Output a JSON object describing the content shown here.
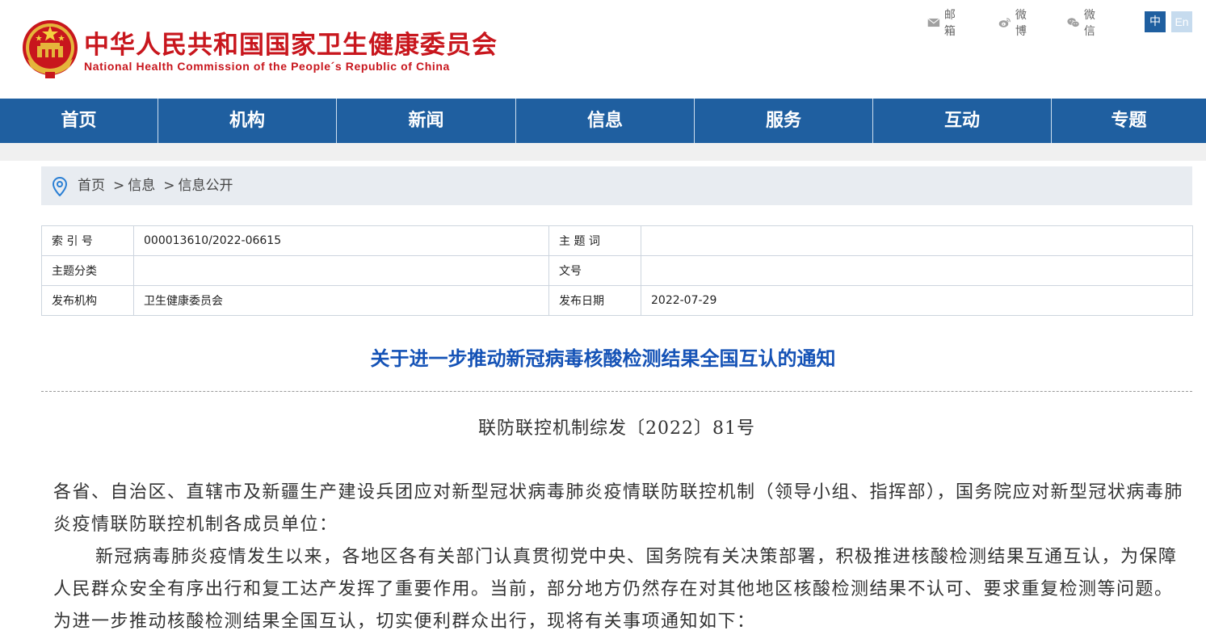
{
  "header": {
    "title_cn": "中华人民共和国国家卫生健康委员会",
    "title_en": "National Health Commission of the People´s Republic of China",
    "links": {
      "mail": {
        "label": "邮箱",
        "icon": "mail-icon"
      },
      "weibo": {
        "label": "微博",
        "icon": "weibo-icon"
      },
      "wechat": {
        "label": "微信",
        "icon": "wechat-icon"
      }
    },
    "lang": {
      "zh": "中",
      "en": "En"
    }
  },
  "nav": [
    "首页",
    "机构",
    "新闻",
    "信息",
    "服务",
    "互动",
    "专题"
  ],
  "breadcrumb": {
    "home": "首页",
    "level1": "信息",
    "level2": "信息公开",
    "sep": ">"
  },
  "meta": {
    "index_label": "索 引 号",
    "index_value": "000013610/2022-06615",
    "subject_word_label": "主 题 词",
    "subject_word_value": "",
    "category_label": "主题分类",
    "category_value": "",
    "docno_label": "文号",
    "docno_value": "",
    "publisher_label": "发布机构",
    "publisher_value": "卫生健康委员会",
    "date_label": "发布日期",
    "date_value": "2022-07-29"
  },
  "article": {
    "title": "关于进一步推动新冠病毒核酸检测结果全国互认的通知",
    "doc_number": "联防联控机制综发〔2022〕81号",
    "p1": "各省、自治区、直辖市及新疆生产建设兵团应对新型冠状病毒肺炎疫情联防联控机制（领导小组、指挥部），国务院应对新型冠状病毒肺炎疫情联防联控机制各成员单位：",
    "p2": "新冠病毒肺炎疫情发生以来，各地区各有关部门认真贯彻党中央、国务院有关决策部署，积极推进核酸检测结果互通互认，为保障人民群众安全有序出行和复工达产发挥了重要作用。当前，部分地方仍然存在对其他地区核酸检测结果不认可、要求重复检测等问题。为进一步推动核酸检测结果全国互认，切实便利群众出行，现将有关事项通知如下："
  },
  "colors": {
    "brand_red": "#c8161d",
    "nav_blue": "#1f5fa0",
    "title_blue": "#1452b6"
  }
}
